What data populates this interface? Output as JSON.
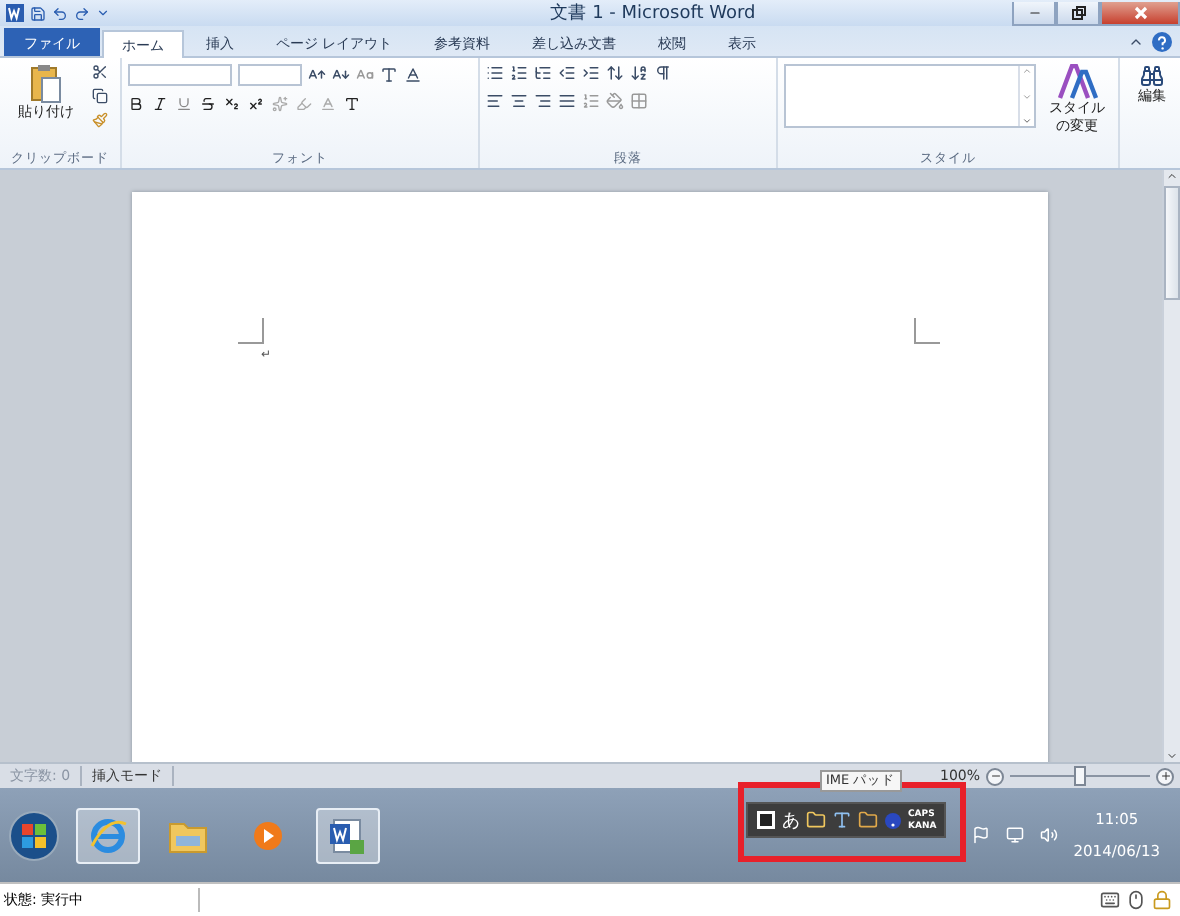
{
  "window": {
    "title": "文書 1 - Microsoft Word"
  },
  "tabs": [
    {
      "label": "ファイル",
      "kind": "file",
      "selected": false
    },
    {
      "label": "ホーム",
      "kind": "tab",
      "selected": true
    },
    {
      "label": "挿入",
      "kind": "tab",
      "selected": false
    },
    {
      "label": "ページ レイアウト",
      "kind": "tab",
      "selected": false
    },
    {
      "label": "参考資料",
      "kind": "tab",
      "selected": false
    },
    {
      "label": "差し込み文書",
      "kind": "tab",
      "selected": false
    },
    {
      "label": "校閲",
      "kind": "tab",
      "selected": false
    },
    {
      "label": "表示",
      "kind": "tab",
      "selected": false
    }
  ],
  "ribbon": {
    "clipboard": {
      "paste": "貼り付け",
      "label": "クリップボード"
    },
    "font": {
      "label": "フォント"
    },
    "paragraph": {
      "label": "段落"
    },
    "styles": {
      "change": "スタイルの変更",
      "label": "スタイル"
    },
    "editing": {
      "label": "編集"
    }
  },
  "document": {
    "paragraph_mark": "↵"
  },
  "status_bar": {
    "items": [
      {
        "label": "文字数: 0",
        "disabled": true
      },
      {
        "label": "挿入モード",
        "disabled": false
      }
    ],
    "zoom": "100%",
    "zoom_slider": {
      "level": 0.5
    }
  },
  "ime_bar": {
    "tooltip": "IME パッド",
    "mode": "あ",
    "caps": "CAPS",
    "kana": "KANA"
  },
  "taskbar": {
    "apps": [
      {
        "kind": "ie",
        "selected": true
      },
      {
        "kind": "explorer",
        "selected": false
      },
      {
        "kind": "media",
        "selected": false
      },
      {
        "kind": "word",
        "selected": true
      }
    ],
    "clock": {
      "time": "11:05",
      "date": "2014/06/13"
    }
  },
  "footer": {
    "status": "状態: 実行中"
  }
}
